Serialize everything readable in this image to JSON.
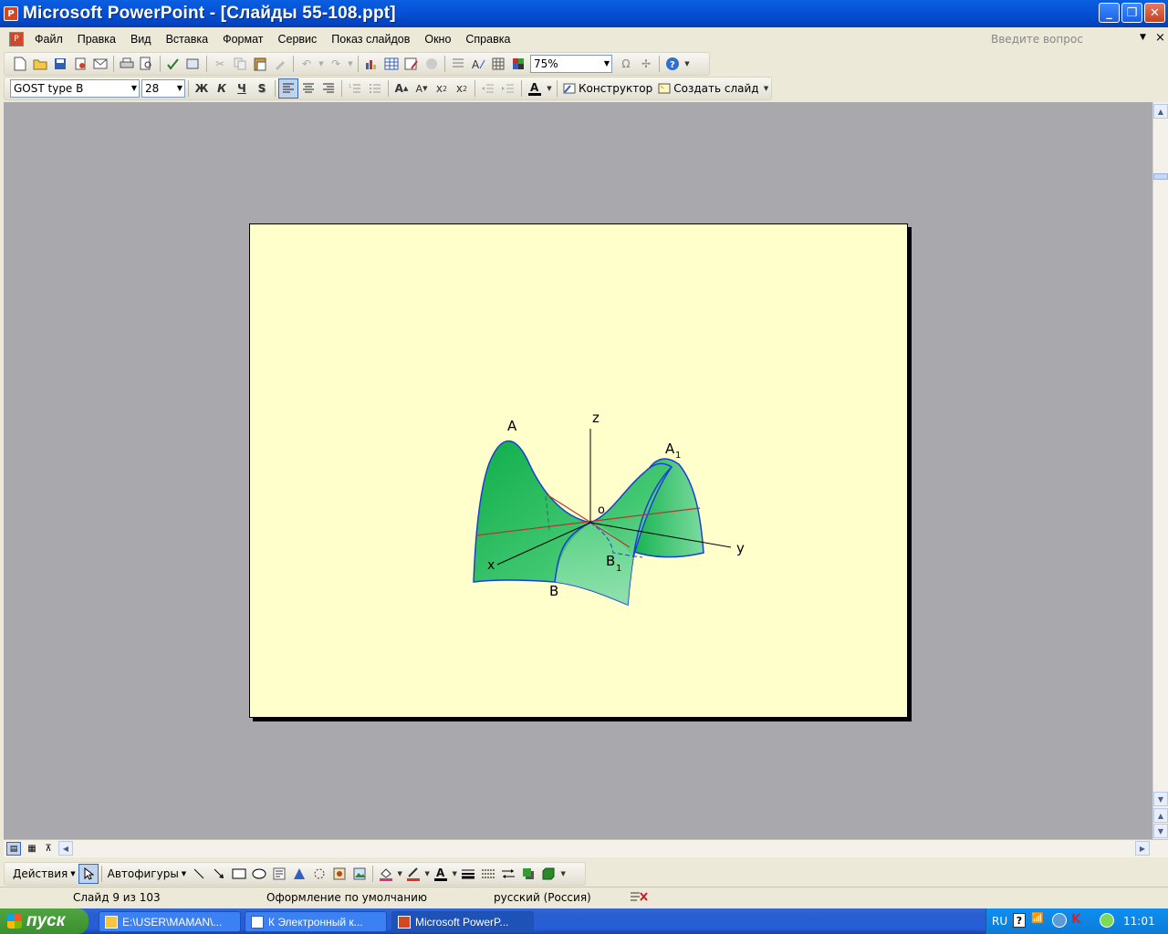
{
  "window": {
    "title": "Microsoft PowerPoint - [Слайды 55-108.ppt]",
    "min": "_",
    "max": "❐",
    "close": "✕"
  },
  "menu": {
    "items": [
      "Файл",
      "Правка",
      "Вид",
      "Вставка",
      "Формат",
      "Сервис",
      "Показ слайдов",
      "Окно",
      "Справка"
    ],
    "ask_placeholder": "Введите вопрос",
    "close_doc": "×"
  },
  "standard_toolbar": {
    "zoom": "75%"
  },
  "formatting_toolbar": {
    "font": "GOST type B",
    "size": "28",
    "bold": "Ж",
    "italic": "К",
    "underline": "Ч",
    "shadow": "S",
    "designer": "Конструктор",
    "new_slide": "Создать слайд"
  },
  "slide": {
    "labels": {
      "A": "A",
      "A1": "A",
      "A1_sub": "1",
      "B": "B",
      "B1": "B",
      "B1_sub": "1",
      "z": "z",
      "y": "y",
      "x": "x",
      "o": "o"
    },
    "colors": {
      "background": "#ffffcc",
      "surface": "#33cc77",
      "edge": "#1a3fd6",
      "axis": "#000000",
      "trace": "#b03a2e"
    }
  },
  "drawing_toolbar": {
    "actions": "Действия",
    "autoshapes": "Автофигуры"
  },
  "status": {
    "slide_of": "Слайд 9 из 103",
    "design": "Оформление по умолчанию",
    "language": "русский (Россия)"
  },
  "taskbar": {
    "start": "пуск",
    "tasks": [
      "E:\\USER\\MAMAN\\...",
      "К Электронный к...",
      "Microsoft PowerP..."
    ],
    "lang": "RU",
    "clock": "11:01"
  }
}
